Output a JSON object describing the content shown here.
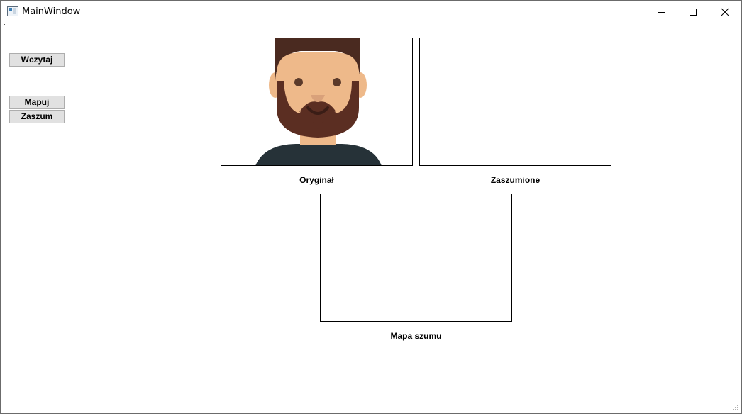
{
  "window": {
    "title": "MainWindow",
    "controls": {
      "minimize_icon": "minimize-icon",
      "maximize_icon": "maximize-icon",
      "close_icon": "close-icon"
    }
  },
  "sidebar": {
    "load_label": "Wczytaj",
    "map_label": "Mapuj",
    "noise_label": "Zaszum"
  },
  "images": {
    "original_caption": "Oryginał",
    "noised_caption": "Zaszumione",
    "noise_map_caption": "Mapa szumu"
  },
  "colors": {
    "frame": "#000000",
    "button_bg": "#e1e1e1",
    "button_border": "#adadad",
    "skin": "#eeb98a",
    "beard": "#5b2e22",
    "hair": "#4a2a20",
    "shirt": "#263238"
  }
}
